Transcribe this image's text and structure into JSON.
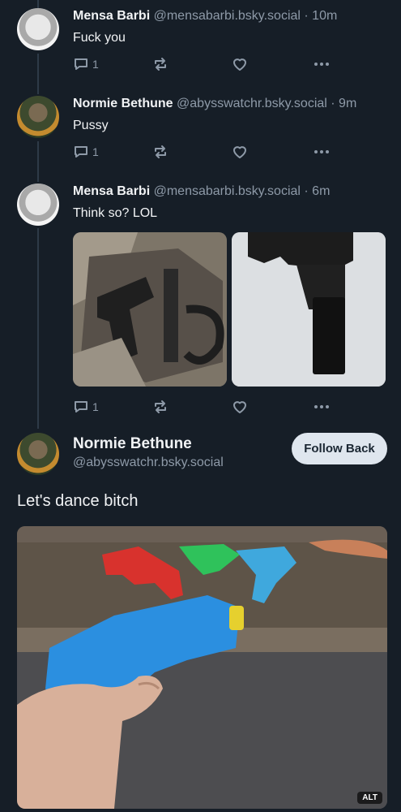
{
  "thread": [
    {
      "author_name": "Mensa Barbi",
      "author_handle": "@mensabarbi.bsky.social",
      "time": "· 10m",
      "text": "Fuck you",
      "reply_count": "1"
    },
    {
      "author_name": "Normie Bethune",
      "author_handle": "@abysswatchr.bsky.social",
      "time": "· 9m",
      "text": "Pussy",
      "reply_count": "1"
    },
    {
      "author_name": "Mensa Barbi",
      "author_handle": "@mensabarbi.bsky.social",
      "time": "· 6m",
      "text": "Think so? LOL",
      "reply_count": "1"
    }
  ],
  "main_post": {
    "author_name": "Normie Bethune",
    "author_handle": "@abysswatchr.bsky.social",
    "follow_label": "Follow Back",
    "text": "Let's dance bitch",
    "alt_badge": "ALT"
  },
  "icons": {
    "reply": "reply-icon",
    "repost": "repost-icon",
    "like": "heart-icon",
    "more": "more-icon"
  },
  "colors": {
    "background": "#161e27",
    "muted": "#8e9aa8",
    "thread_line": "#2e3a47",
    "follow_button": "#dfe6ee"
  }
}
